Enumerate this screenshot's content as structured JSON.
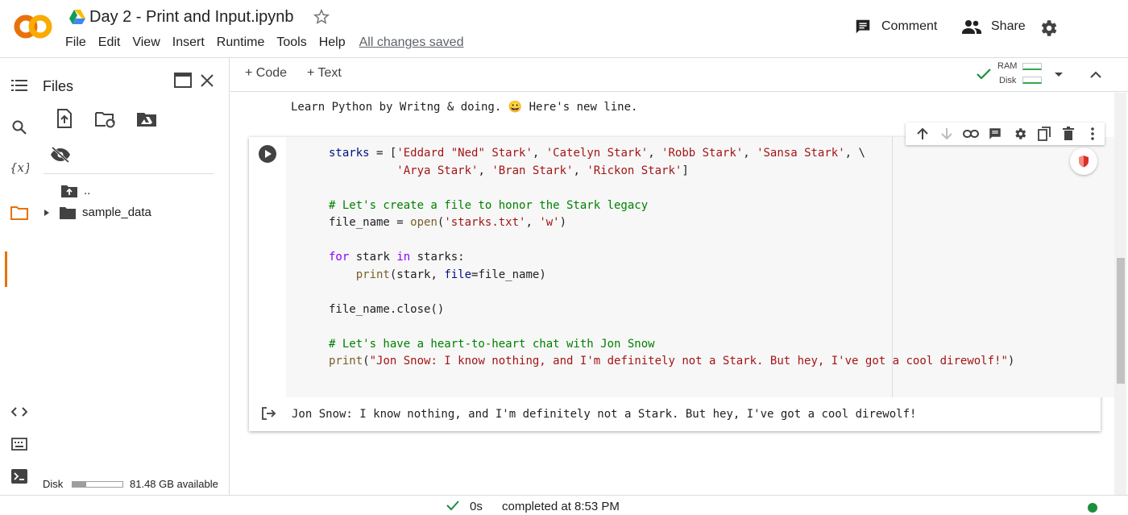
{
  "app": {
    "logo_text": "CO",
    "title": "Day 2 - Print and Input.ipynb",
    "menu": [
      "File",
      "Edit",
      "View",
      "Insert",
      "Runtime",
      "Tools",
      "Help"
    ],
    "save_status": "All changes saved",
    "comment_label": "Comment",
    "share_label": "Share"
  },
  "sidebar": {
    "panel_title": "Files",
    "tree": [
      {
        "label": "..",
        "type": "parent"
      },
      {
        "label": "sample_data",
        "type": "folder"
      }
    ],
    "disk_label": "Disk",
    "disk_used_fraction": 0.27,
    "disk_available": "81.48 GB available"
  },
  "toolbar": {
    "code_button": "+ Code",
    "text_button": "+ Text",
    "ram_label": "RAM",
    "disk_label": "Disk"
  },
  "notebook": {
    "text_cell": "Learn Python by Writng & doing. 😀 Here's new line.",
    "output": "Jon Snow: I know nothing, and I'm definitely not a Stark. But hey, I've got a cool direwolf!"
  },
  "status": {
    "duration": "0s",
    "completed": "completed at 8:53 PM"
  },
  "colors": {
    "logo_orange": "#f9ab00",
    "logo_dark_orange": "#e8710a",
    "accent_green": "#1e8e3e"
  }
}
